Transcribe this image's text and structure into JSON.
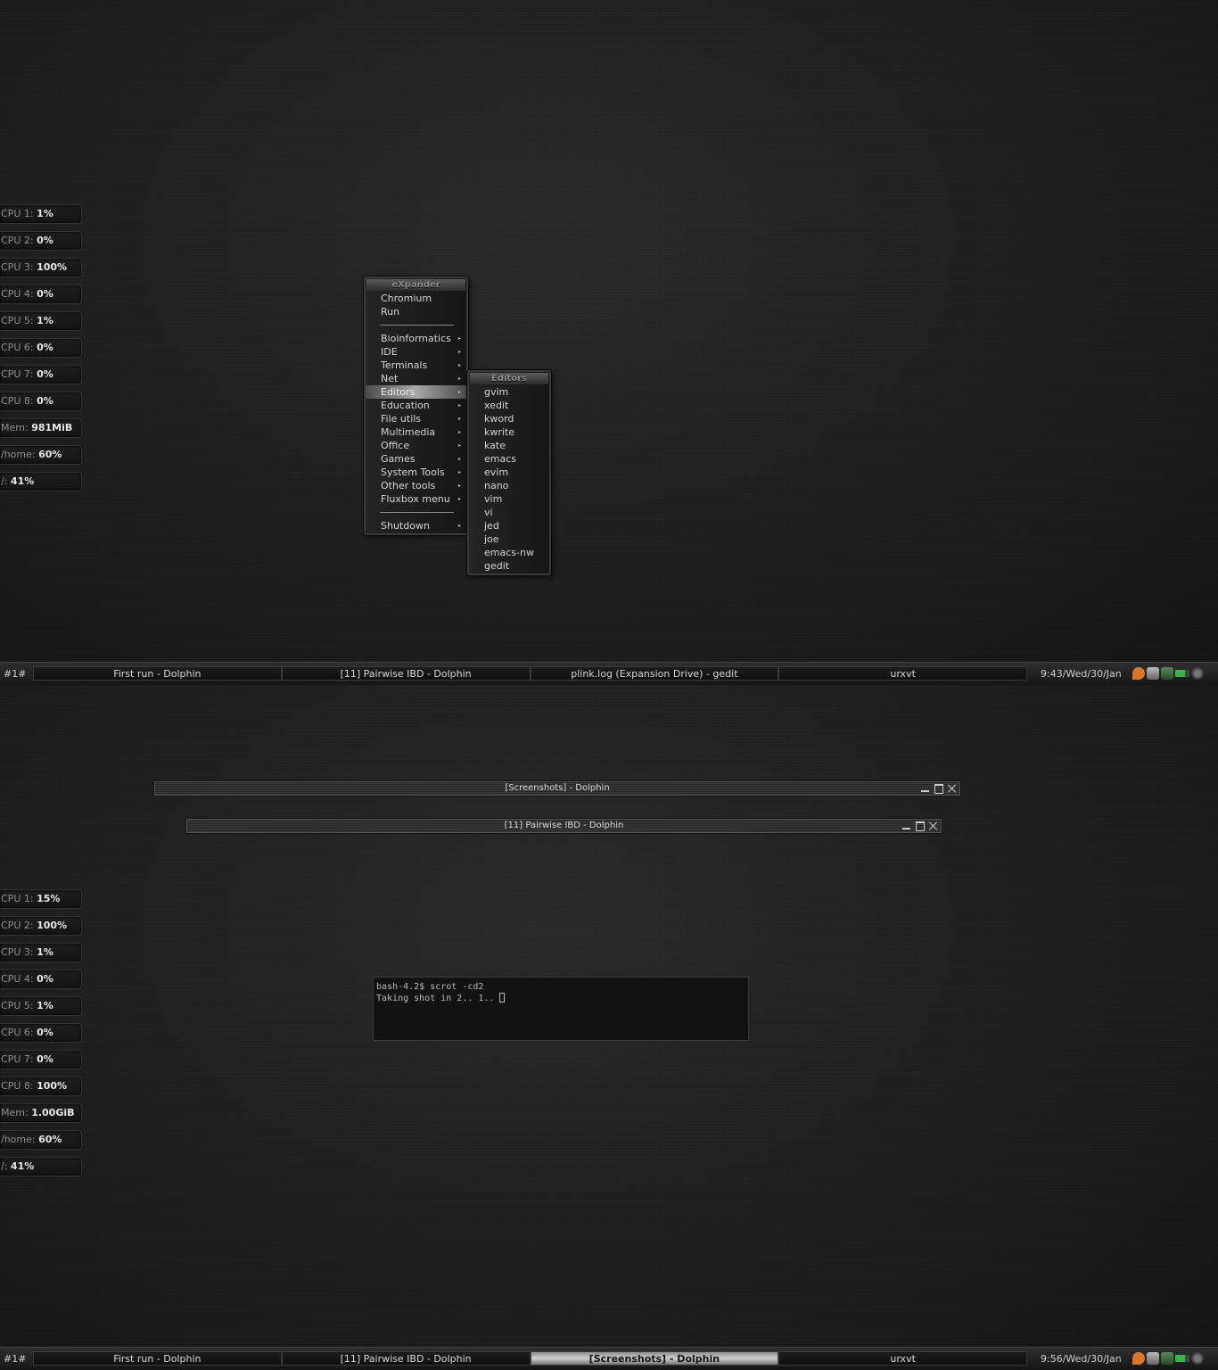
{
  "screen1": {
    "stats": [
      {
        "label": "CPU 1:",
        "value": "1%"
      },
      {
        "label": "CPU 2:",
        "value": "0%"
      },
      {
        "label": "CPU 3:",
        "value": "100%"
      },
      {
        "label": "CPU 4:",
        "value": "0%"
      },
      {
        "label": "CPU 5:",
        "value": "1%"
      },
      {
        "label": "CPU 6:",
        "value": "0%"
      },
      {
        "label": "CPU 7:",
        "value": "0%"
      },
      {
        "label": "CPU 8:",
        "value": "0%"
      },
      {
        "label": "Mem:",
        "value": "981MiB"
      },
      {
        "label": "/home:",
        "value": "60%"
      },
      {
        "label": "/:",
        "value": "41%"
      }
    ],
    "root_menu": {
      "title": "eXpander",
      "items": [
        {
          "label": "Chromium"
        },
        {
          "label": "Run"
        },
        {
          "label": "Bioinformatics",
          "arrow": "▸"
        },
        {
          "label": "IDE",
          "arrow": "▸"
        },
        {
          "label": "Terminals",
          "arrow": "▸"
        },
        {
          "label": "Net",
          "arrow": "▸"
        },
        {
          "label": "Editors",
          "arrow": "▸"
        },
        {
          "label": "Education",
          "arrow": "▸"
        },
        {
          "label": "File utils",
          "arrow": "▸"
        },
        {
          "label": "Multimedia",
          "arrow": "▸"
        },
        {
          "label": "Office",
          "arrow": "▸"
        },
        {
          "label": "Games",
          "arrow": "▸"
        },
        {
          "label": "System Tools",
          "arrow": "▸"
        },
        {
          "label": "Other tools",
          "arrow": "▸"
        },
        {
          "label": "Fluxbox menu",
          "arrow": "▸"
        },
        {
          "label": "Shutdown",
          "arrow": "▸"
        }
      ]
    },
    "editors_menu": {
      "title": "Editors",
      "items": [
        "gvim",
        "xedit",
        "kword",
        "kwrite",
        "kate",
        "emacs",
        "evim",
        "nano",
        "vim",
        "vi",
        "jed",
        "joe",
        "emacs-nw",
        "gedit"
      ]
    },
    "taskbar": {
      "workspace": "#1#",
      "tasks": [
        "First run - Dolphin",
        "[11] Pairwise IBD - Dolphin",
        "plink.log (Expansion Drive) - gedit",
        "urxvt"
      ],
      "clock": "9:43/Wed/30/Jan"
    }
  },
  "screen2": {
    "stats": [
      {
        "label": "CPU 1:",
        "value": "15%"
      },
      {
        "label": "CPU 2:",
        "value": "100%"
      },
      {
        "label": "CPU 3:",
        "value": "1%"
      },
      {
        "label": "CPU 4:",
        "value": "0%"
      },
      {
        "label": "CPU 5:",
        "value": "1%"
      },
      {
        "label": "CPU 6:",
        "value": "0%"
      },
      {
        "label": "CPU 7:",
        "value": "0%"
      },
      {
        "label": "CPU 8:",
        "value": "100%"
      },
      {
        "label": "Mem:",
        "value": "1.00GiB"
      },
      {
        "label": "/home:",
        "value": "60%"
      },
      {
        "label": "/:",
        "value": "41%"
      }
    ],
    "windows": [
      {
        "title": "[Screenshots] - Dolphin"
      },
      {
        "title": "[11] Pairwise IBD - Dolphin"
      }
    ],
    "terminal": {
      "line1": "bash-4.2$ scrot -cd2",
      "line2": "Taking shot in 2.. 1.. "
    },
    "taskbar": {
      "workspace": "#1#",
      "tasks": [
        "First run - Dolphin",
        "[11] Pairwise IBD - Dolphin",
        "[Screenshots] - Dolphin",
        "urxvt"
      ],
      "clock": "9:56/Wed/30/Jan"
    }
  },
  "colors": {
    "background": "#1b1b1b",
    "menu_highlight": "#a8a8a8",
    "stat_value": "#e8e8e8",
    "stat_label": "#8c8c8c",
    "tray_orange": "#d9782d",
    "tray_green": "#3cb34a"
  },
  "icons": [
    "tray-app-icon",
    "tray-network-icon",
    "tray-update-icon",
    "tray-battery-icon",
    "tray-power-icon"
  ]
}
